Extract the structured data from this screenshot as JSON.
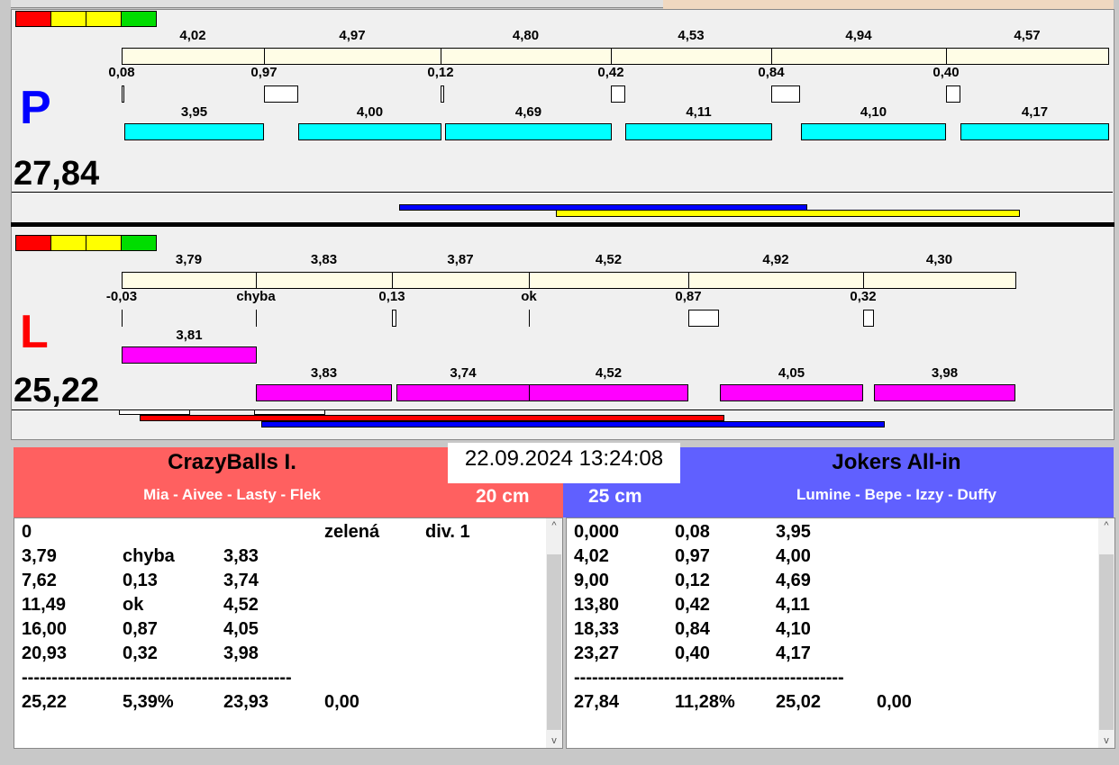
{
  "colors": {
    "red": "#ff0000",
    "yellow": "#ffff00",
    "green": "#00dd00",
    "beige": "#fffde6",
    "cyan": "#00ffff",
    "magenta": "#ff00ff",
    "red_team": "#ff6060",
    "blue_team": "#6060ff"
  },
  "p": {
    "letter": "P",
    "total": "27,84",
    "segments": [
      "4,02",
      "4,97",
      "4,80",
      "4,53",
      "4,94",
      "4,57"
    ],
    "gaps": [
      "0,08",
      "0,97",
      "0,12",
      "0,42",
      "0,84",
      "0,40"
    ],
    "times": [
      "3,95",
      "4,00",
      "4,69",
      "4,11",
      "4,10",
      "4,17"
    ]
  },
  "l": {
    "letter": "L",
    "total": "25,22",
    "segments": [
      "3,79",
      "3,83",
      "3,87",
      "4,52",
      "4,92",
      "4,30"
    ],
    "gaps": [
      "-0,03",
      "chyba",
      "0,13",
      "ok",
      "0,87",
      "0,32"
    ],
    "times": [
      "3,81",
      "3,83",
      "3,74",
      "4,52",
      "4,05",
      "3,98"
    ]
  },
  "header": {
    "left_team": "CrazyBalls I.",
    "left_players": "Mia - Aivee - Lasty - Flek",
    "left_size": "20 cm",
    "datetime": "22.09.2024 13:24:08",
    "right_team": "Jokers All-in",
    "right_players": "Lumine - Bepe - Izzy - Duffy",
    "right_size": "25 cm"
  },
  "left_log": {
    "rows": [
      [
        "0",
        "",
        "",
        "zelená",
        "div. 1"
      ],
      [
        "3,79",
        "chyba",
        "3,83"
      ],
      [
        "7,62",
        "0,13",
        "3,74"
      ],
      [
        "11,49",
        "ok",
        "4,52"
      ],
      [
        "16,00",
        "0,87",
        "4,05"
      ],
      [
        "20,93",
        "0,32",
        "3,98"
      ]
    ],
    "separator": "---------------------------------------------",
    "summary": [
      "25,22",
      "5,39%",
      "23,93",
      "0,00"
    ]
  },
  "right_log": {
    "rows": [
      [
        "0,000",
        "0,08",
        "3,95"
      ],
      [
        "4,02",
        "0,97",
        "4,00"
      ],
      [
        "9,00",
        "0,12",
        "4,69"
      ],
      [
        "13,80",
        "0,42",
        "4,11"
      ],
      [
        "18,33",
        "0,84",
        "4,10"
      ],
      [
        "23,27",
        "0,40",
        "4,17"
      ]
    ],
    "separator": "---------------------------------------------",
    "summary": [
      "27,84",
      "11,28%",
      "25,02",
      "0,00"
    ]
  }
}
